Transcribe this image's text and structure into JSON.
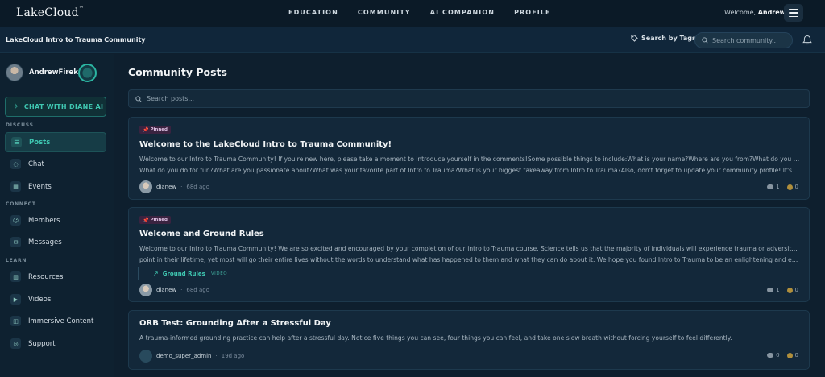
{
  "app": {
    "logo": "LakeCloud",
    "logo_mark": "™"
  },
  "nav": {
    "links": [
      "EDUCATION",
      "COMMUNITY",
      "AI COMPANION",
      "PROFILE"
    ],
    "welcome_prefix": "Welcome,",
    "welcome_user": "Andrew"
  },
  "subbar": {
    "community_name": "LakeCloud Intro to Trauma Community",
    "tags_label": "Search by Tags",
    "search_placeholder": "Search community..."
  },
  "sidebar": {
    "user_name": "AndrewFirek",
    "chat_ai_label": "CHAT WITH DIANE AI",
    "sections": {
      "discuss": "DISCUSS",
      "connect": "CONNECT",
      "learn": "LEARN"
    },
    "items": [
      {
        "label": "Posts",
        "icon": "posts-icon",
        "active": true
      },
      {
        "label": "Chat",
        "icon": "chat-icon"
      },
      {
        "label": "Events",
        "icon": "calendar-icon"
      },
      {
        "label": "Members",
        "icon": "members-icon"
      },
      {
        "label": "Messages",
        "icon": "mail-icon"
      },
      {
        "label": "Resources",
        "icon": "book-icon"
      },
      {
        "label": "Videos",
        "icon": "video-icon"
      },
      {
        "label": "Immersive Content",
        "icon": "vr-icon"
      },
      {
        "label": "Support",
        "icon": "support-icon"
      }
    ]
  },
  "main": {
    "title": "Community Posts",
    "search_placeholder": "Search posts...",
    "posts": [
      {
        "pinned_label": "Pinned",
        "title": "Welcome to the LakeCloud Intro to Trauma Community!",
        "body_line1": "Welcome to our Intro to Trauma Community! If you're new here, please take a moment to introduce yourself in the comments!Some possible things to include:What is your name?Where are you from?What do you do for work?",
        "body_line2": "What do you do for fun?What are you passionate about?What was your favorite part of Intro to Trauma?What is your biggest takeaway from Intro to Trauma?Also, don't forget to update your community profile! It's a great way...",
        "author": "dianew",
        "time": "68d ago",
        "comments": "1",
        "coins": "0"
      },
      {
        "pinned_label": "Pinned",
        "title": "Welcome and Ground Rules",
        "body_line1": "Welcome to our Intro to Trauma Community! We are so excited and encouraged by your completion of our intro to Trauma course. Science tells us that the majority of individuals will experience trauma or adversity at some",
        "body_line2": "point in their lifetime, yet most will go their entire lives without the words to understand what has happened to them and what they can do about it. We hope you found Intro to Trauma to be an enlightening and encouraging...",
        "attachment_name": "Ground Rules",
        "attachment_type": "VIDEO",
        "author": "dianew",
        "time": "68d ago",
        "comments": "1",
        "coins": "0"
      },
      {
        "title": "ORB Test: Grounding After a Stressful Day",
        "body_line1": "A trauma-informed grounding practice can help after a stressful day. Notice five things you can see, four things you can feel, and take one slow breath without forcing yourself to feel differently.",
        "author": "demo_super_admin",
        "time": "19d ago",
        "comments": "0",
        "coins": "0"
      }
    ]
  },
  "colors": {
    "accent": "#3fc7b1",
    "background": "#0e1f2e",
    "pinned_badge": "#3a2340"
  }
}
